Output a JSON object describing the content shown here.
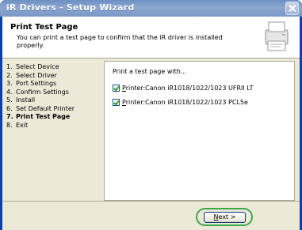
{
  "window": {
    "title": "iR Drivers - Setup Wizard"
  },
  "header": {
    "title": "Print Test Page",
    "subtitle": "You can print a test page to confirm that the iR driver is installed properly."
  },
  "steps": [
    {
      "num": "1.",
      "label": "Select Device",
      "active": false
    },
    {
      "num": "2.",
      "label": "Select Driver",
      "active": false
    },
    {
      "num": "3.",
      "label": "Port Settings",
      "active": false
    },
    {
      "num": "4.",
      "label": "Confirm Settings",
      "active": false
    },
    {
      "num": "5.",
      "label": "Install",
      "active": false
    },
    {
      "num": "6.",
      "label": "Set Default Printer",
      "active": false
    },
    {
      "num": "7.",
      "label": "Print Test Page",
      "active": true
    },
    {
      "num": "8.",
      "label": "Exit",
      "active": false
    }
  ],
  "content": {
    "prompt": "Print a test page with...",
    "printers": [
      {
        "accel": "P",
        "rest": "rinter:Canon iR1018/1022/1023 UFRII LT",
        "checked": true
      },
      {
        "accel": "P",
        "rest": "rinter:Canon iR1018/1022/1023 PCL5e",
        "checked": true
      }
    ]
  },
  "buttons": {
    "next_accel": "N",
    "next_rest": "ext >"
  },
  "colors": {
    "highlight_ring": "#3fa84a",
    "check": "#21a121"
  }
}
